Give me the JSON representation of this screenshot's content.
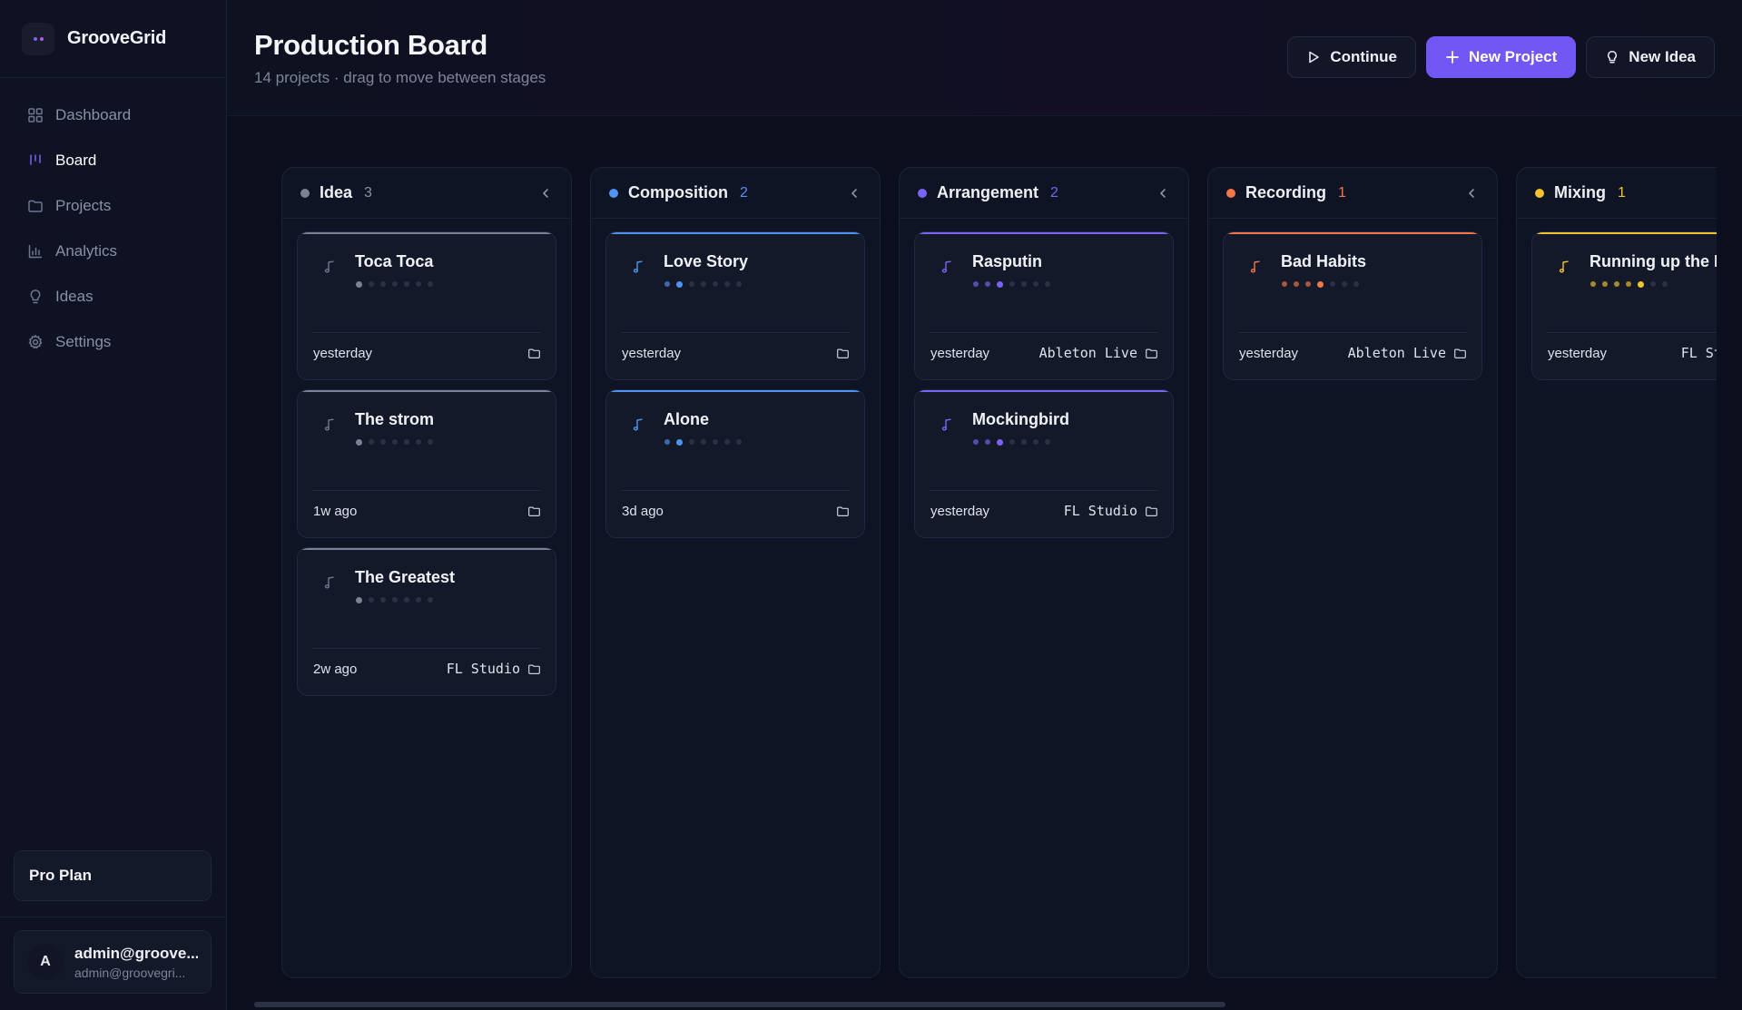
{
  "app": {
    "name": "GrooveGrid"
  },
  "sidebar": {
    "items": [
      {
        "label": "Dashboard",
        "icon": "grid-icon",
        "active": false
      },
      {
        "label": "Board",
        "icon": "kanban-icon",
        "active": true
      },
      {
        "label": "Projects",
        "icon": "folder-icon",
        "active": false
      },
      {
        "label": "Analytics",
        "icon": "bar-chart-icon",
        "active": false
      },
      {
        "label": "Ideas",
        "icon": "lightbulb-icon",
        "active": false
      },
      {
        "label": "Settings",
        "icon": "gear-icon",
        "active": false
      }
    ],
    "plan": "Pro Plan",
    "user": {
      "initial": "A",
      "name": "admin@groove...",
      "email": "admin@groovegri..."
    }
  },
  "header": {
    "title": "Production Board",
    "subtitle": "14 projects · drag to move between stages",
    "continue_label": "Continue",
    "new_project_label": "New Project",
    "new_idea_label": "New Idea"
  },
  "colors": {
    "accent": "#7257f5"
  },
  "columns": [
    {
      "title": "Idea",
      "count": "3",
      "color": "#7c8296",
      "countColor": "#8a90a6",
      "cards": [
        {
          "title": "Toca Toca",
          "time": "yesterday",
          "daw": "",
          "progress": 1
        },
        {
          "title": "The strom",
          "time": "1w ago",
          "daw": "",
          "progress": 1
        },
        {
          "title": "The Greatest",
          "time": "2w ago",
          "daw": "FL Studio",
          "progress": 1
        }
      ]
    },
    {
      "title": "Composition",
      "count": "2",
      "color": "#4f93f3",
      "countColor": "#4f93f3",
      "cards": [
        {
          "title": "Love Story",
          "time": "yesterday",
          "daw": "",
          "progress": 2
        },
        {
          "title": "Alone",
          "time": "3d ago",
          "daw": "",
          "progress": 2
        }
      ]
    },
    {
      "title": "Arrangement",
      "count": "2",
      "color": "#7b63f5",
      "countColor": "#7b63f5",
      "cards": [
        {
          "title": "Rasputin",
          "time": "yesterday",
          "daw": "Ableton Live",
          "progress": 3
        },
        {
          "title": "Mockingbird",
          "time": "yesterday",
          "daw": "FL Studio",
          "progress": 3
        }
      ]
    },
    {
      "title": "Recording",
      "count": "1",
      "color": "#f2764a",
      "countColor": "#f2764a",
      "cards": [
        {
          "title": "Bad Habits",
          "time": "yesterday",
          "daw": "Ableton Live",
          "progress": 4
        }
      ]
    },
    {
      "title": "Mixing",
      "count": "1",
      "color": "#f2c230",
      "countColor": "#f2c230",
      "cards": [
        {
          "title": "Running up the Hill",
          "time": "yesterday",
          "daw": "FL Studio",
          "progress": 5
        }
      ]
    }
  ]
}
